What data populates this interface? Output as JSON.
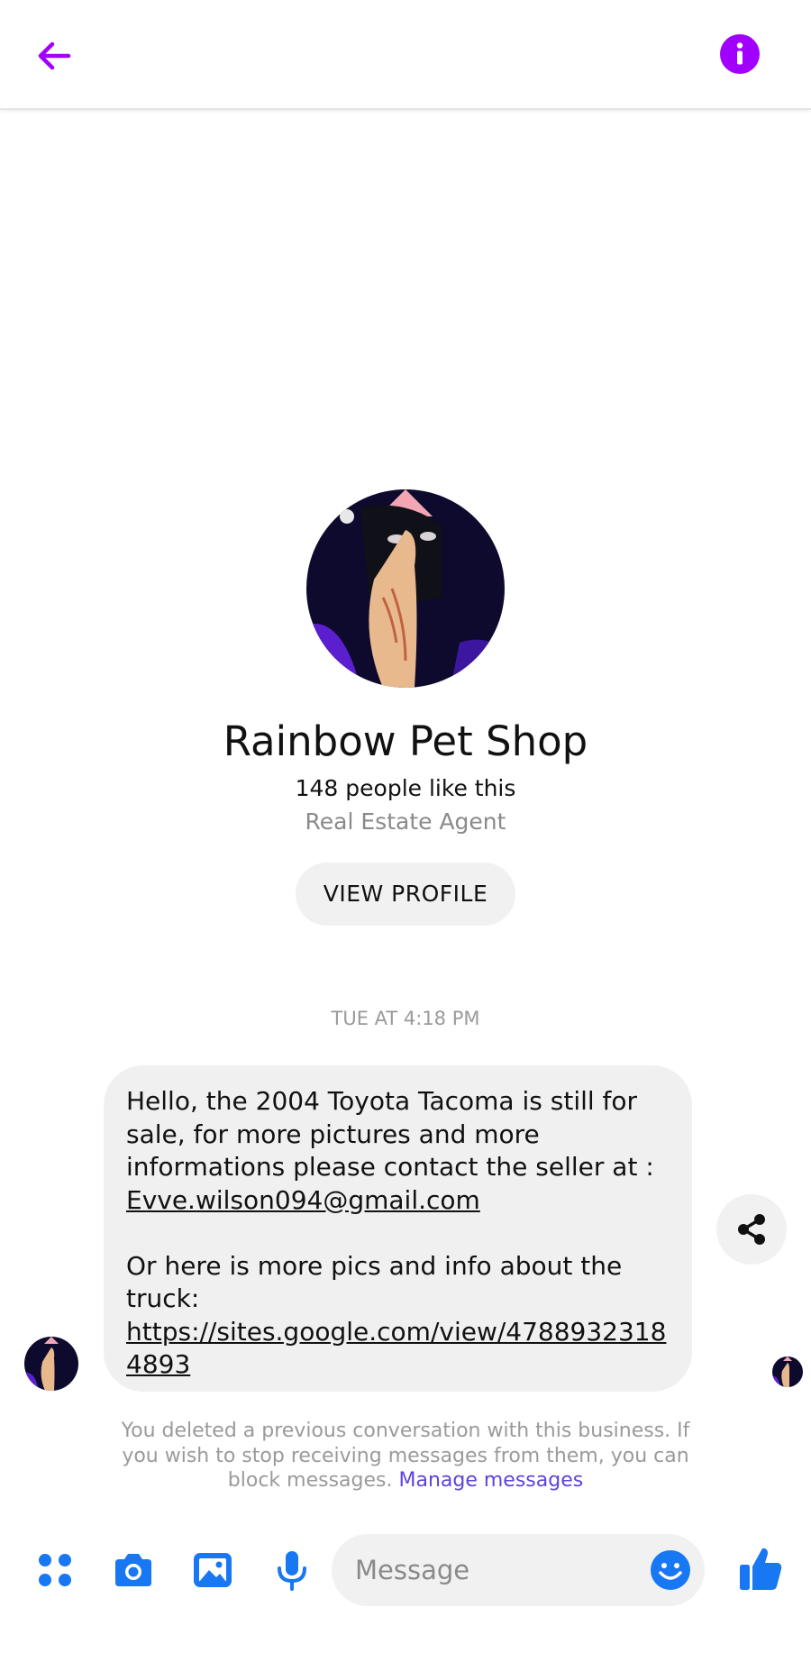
{
  "app": {
    "accent_color": "#a100ff",
    "composer_color": "#1877f2"
  },
  "header": {
    "back_icon": "arrow-left-icon",
    "info_icon": "info-icon"
  },
  "profile": {
    "name": "Rainbow Pet Shop",
    "likes": "148 people like this",
    "category": "Real Estate Agent",
    "view_profile_label": "VIEW PROFILE"
  },
  "conversation": {
    "timestamp": "TUE AT 4:18 PM",
    "message": {
      "line1": "Hello, the 2004 Toyota Tacoma is still for sale, for more pictures and more informations please contact the seller at :",
      "email": "Evve.wilson094@gmail.com",
      "line2": "Or here is more pics and info about the truck:",
      "url": "https://sites.google.com/view/47889323184893"
    },
    "share_icon": "share-icon"
  },
  "notice": {
    "text": "You deleted a previous conversation with this business. If you wish to stop receiving messages from them, you can block messages.",
    "link_label": "Manage messages"
  },
  "composer": {
    "placeholder": "Message",
    "icons": [
      "apps-icon",
      "camera-icon",
      "gallery-icon",
      "microphone-icon",
      "emoji-icon",
      "thumbs-up-icon"
    ]
  }
}
